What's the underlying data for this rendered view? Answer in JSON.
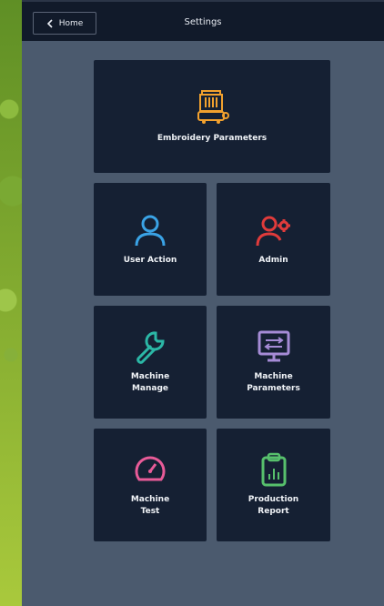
{
  "header": {
    "home_label": "Home",
    "title": "Settings"
  },
  "tiles": [
    {
      "label": "Embroidery Parameters",
      "icon": "embroidery-machine-icon",
      "color": "#f2a12e"
    },
    {
      "label": "User Action",
      "icon": "user-icon",
      "color": "#3aa3e6"
    },
    {
      "label": "Admin",
      "icon": "admin-user-gear-icon",
      "color": "#e03b3b"
    },
    {
      "label": "Machine Manage",
      "icon": "wrench-icon",
      "color": "#2bb7a6"
    },
    {
      "label": "Machine Parameters",
      "icon": "monitor-settings-icon",
      "color": "#a58bd6"
    },
    {
      "label": "Machine Test",
      "icon": "gauge-icon",
      "color": "#e85b98"
    },
    {
      "label": "Production Report",
      "icon": "clipboard-chart-icon",
      "color": "#57c06c"
    }
  ]
}
